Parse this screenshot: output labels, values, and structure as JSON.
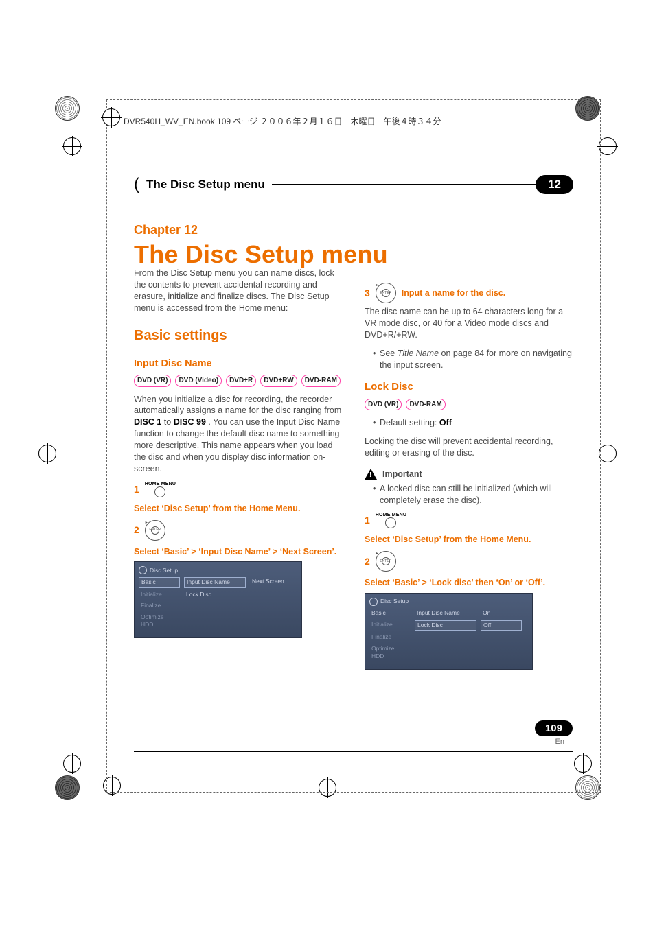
{
  "header": {
    "file_line": "DVR540H_WV_EN.book 109 ページ ２００６年２月１６日　木曜日　午後４時３４分"
  },
  "section_bar": {
    "title": "The Disc Setup menu",
    "chapter_num": "12"
  },
  "chapter": {
    "label": "Chapter 12",
    "title": "The Disc Setup menu"
  },
  "left": {
    "intro": "From the Disc Setup menu you can name discs, lock the contents to prevent accidental recording and erasure, initialize and finalize discs. The Disc Setup menu is accessed from the Home menu:",
    "basic_settings_heading": "Basic settings",
    "input_disc_name_heading": "Input Disc Name",
    "badges": [
      "DVD (VR)",
      "DVD (Video)",
      "DVD+R",
      "DVD+RW",
      "DVD-RAM"
    ],
    "para1_a": "When you initialize a disc for recording, the recorder automatically assigns a name for the disc ranging from ",
    "para1_b": "DISC 1",
    "para1_c": " to ",
    "para1_d": "DISC 99",
    "para1_e": ". You can use the Input Disc Name function to change the default disc name to something more descriptive. This name appears when you load the disc and when you display disc information on-screen.",
    "step1_num": "1",
    "step1_btn_label": "HOME MENU",
    "step1_text": "Select ‘Disc Setup’ from the Home Menu.",
    "step2_num": "2",
    "step2_btn_label": "ENTER",
    "step2_text": "Select ‘Basic’ > ‘Input Disc Name’ > ‘Next Screen’.",
    "osd": {
      "title": "Disc Setup",
      "rows": {
        "r0c0": "Basic",
        "r0c1": "Input Disc Name",
        "r0c2": "Next Screen",
        "r1c0": "Initialize",
        "r1c1": "Lock Disc",
        "r2c0": "Finalize",
        "r3c0": "Optimize HDD"
      }
    }
  },
  "right": {
    "step3_num": "3",
    "step3_btn_label": "ENTER",
    "step3_text": "Input a name for the disc.",
    "step3_para": "The disc name can be up to 64 characters long for a VR mode disc, or 40 for a Video mode discs and DVD+R/+RW.",
    "see_bullet_a": "See ",
    "see_bullet_b": "Title Name",
    "see_bullet_c": " on page 84 for more on navigating the input screen.",
    "lock_disc_heading": "Lock Disc",
    "lock_badges": [
      "DVD (VR)",
      "DVD-RAM"
    ],
    "default_label": "Default setting: ",
    "default_value": "Off",
    "lock_para": "Locking the disc will prevent accidental recording, editing or erasing of the disc.",
    "important_label": "Important",
    "important_bullet": "A locked disc can still be initialized (which will completely erase the disc).",
    "lstep1_num": "1",
    "lstep1_btn_label": "HOME MENU",
    "lstep1_text": "Select ‘Disc Setup’ from the Home Menu.",
    "lstep2_num": "2",
    "lstep2_btn_label": "ENTER",
    "lstep2_text": "Select ‘Basic’ > ‘Lock disc’ then ‘On’ or ‘Off’.",
    "osd": {
      "title": "Disc Setup",
      "rows": {
        "r0c0": "Basic",
        "r0c1": "Input Disc Name",
        "r0c2": "On",
        "r1c0": "Initialize",
        "r1c1": "Lock Disc",
        "r1c2": "Off",
        "r2c0": "Finalize",
        "r3c0": "Optimize HDD"
      }
    }
  },
  "footer": {
    "page_number": "109",
    "lang": "En"
  }
}
